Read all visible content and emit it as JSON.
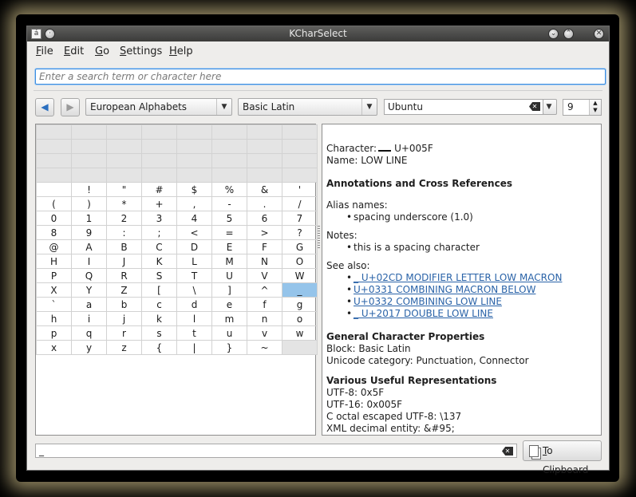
{
  "window": {
    "title": "KCharSelect",
    "app_icon_glyph": "á"
  },
  "menu": [
    {
      "key": "F",
      "rest": "ile"
    },
    {
      "key": "E",
      "rest": "dit"
    },
    {
      "key": "G",
      "rest": "o"
    },
    {
      "key": "S",
      "rest": "ettings"
    },
    {
      "key": "H",
      "rest": "elp"
    }
  ],
  "search": {
    "placeholder": "Enter a search term or character here"
  },
  "toolbar": {
    "section": "European Alphabets",
    "block": "Basic Latin",
    "font": "Ubuntu",
    "font_size": "9"
  },
  "grid": {
    "rows": [
      [
        "",
        "",
        "",
        "",
        "",
        "",
        "",
        ""
      ],
      [
        "",
        "",
        "",
        "",
        "",
        "",
        "",
        ""
      ],
      [
        "",
        "",
        "",
        "",
        "",
        "",
        "",
        ""
      ],
      [
        "",
        "",
        "",
        "",
        "",
        "",
        "",
        ""
      ],
      [
        " ",
        "!",
        "\"",
        "#",
        "$",
        "%",
        "&",
        "'"
      ],
      [
        "(",
        ")",
        "*",
        "+",
        ",",
        "-",
        ".",
        "/"
      ],
      [
        "0",
        "1",
        "2",
        "3",
        "4",
        "5",
        "6",
        "7"
      ],
      [
        "8",
        "9",
        ":",
        ";",
        "<",
        "=",
        ">",
        "?"
      ],
      [
        "@",
        "A",
        "B",
        "C",
        "D",
        "E",
        "F",
        "G"
      ],
      [
        "H",
        "I",
        "J",
        "K",
        "L",
        "M",
        "N",
        "O"
      ],
      [
        "P",
        "Q",
        "R",
        "S",
        "T",
        "U",
        "V",
        "W"
      ],
      [
        "X",
        "Y",
        "Z",
        "[",
        "\\",
        "]",
        "^",
        "_"
      ],
      [
        "`",
        "a",
        "b",
        "c",
        "d",
        "e",
        "f",
        "g"
      ],
      [
        "h",
        "i",
        "j",
        "k",
        "l",
        "m",
        "n",
        "o"
      ],
      [
        "p",
        "q",
        "r",
        "s",
        "t",
        "u",
        "v",
        "w"
      ],
      [
        "x",
        "y",
        "z",
        "{",
        "|",
        "}",
        "~",
        ""
      ]
    ],
    "empty_rows": [
      0,
      1,
      2,
      3
    ],
    "selected": [
      11,
      7
    ],
    "empty_cells": [
      [
        15,
        7
      ]
    ]
  },
  "info": {
    "character_label": "Character:",
    "character_code": "U+005F",
    "name_line": "Name: LOW LINE",
    "annotations_heading": "Annotations and Cross References",
    "alias_label": "Alias names:",
    "alias_item": "spacing underscore (1.0)",
    "notes_label": "Notes:",
    "notes_item": "this is a spacing character",
    "see_also_label": "See also:",
    "see_also": [
      "_ U+02CD MODIFIER LETTER LOW MACRON",
      " U+0331 COMBINING MACRON BELOW",
      " U+0332 COMBINING LOW LINE",
      "_ U+2017 DOUBLE LOW LINE"
    ],
    "general_heading": "General Character Properties",
    "block_line": "Block: Basic Latin",
    "category_line": "Unicode category: Punctuation, Connector",
    "repr_heading": "Various Useful Representations",
    "utf8": "UTF-8: 0x5F",
    "utf16": "UTF-16: 0x005F",
    "octal": "C octal escaped UTF-8: \\137",
    "xml": "XML decimal entity: &#95;"
  },
  "bottom": {
    "text": "_",
    "clipboard_key": "T",
    "clipboard_rest": "o Clipboard"
  },
  "icons": {
    "back": "back-arrow-icon",
    "forward": "forward-arrow-icon",
    "clear": "clear-text-icon",
    "clipboard": "clipboard-icon"
  }
}
